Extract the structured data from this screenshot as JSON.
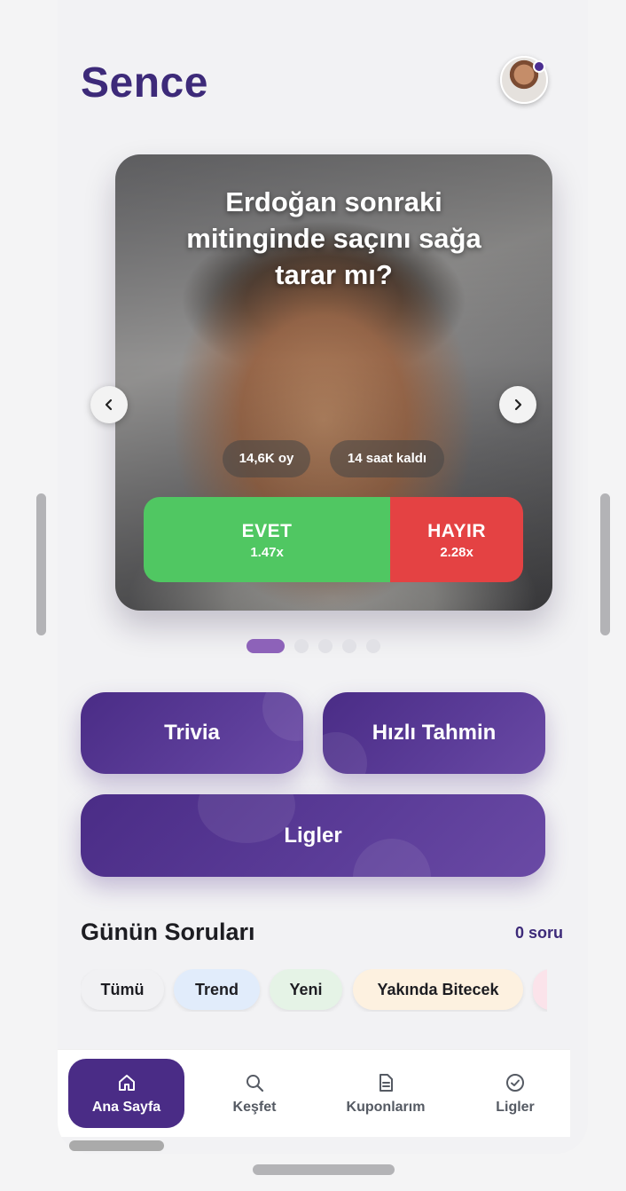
{
  "app": {
    "title": "Sence"
  },
  "hero_card": {
    "question": "Erdoğan sonraki mitinginde saçını sağa tarar mı?",
    "votes": "14,6K oy",
    "time_left": "14 saat kaldı",
    "yes": {
      "label": "EVET",
      "odds": "1.47x"
    },
    "no": {
      "label": "HAYIR",
      "odds": "2.28x"
    },
    "yes_share": 0.65
  },
  "carousel": {
    "total": 5,
    "active_index": 0
  },
  "games": {
    "trivia": "Trivia",
    "quick_guess": "Hızlı Tahmin",
    "leagues": "Ligler"
  },
  "section": {
    "title": "Günün Soruları",
    "count": "0 soru"
  },
  "filters": [
    {
      "label": "Tümü",
      "color": "#f1f1f3"
    },
    {
      "label": "Trend",
      "color": "#e1ecfb"
    },
    {
      "label": "Yeni",
      "color": "#e5f3e6"
    },
    {
      "label": "Yakında Bitecek",
      "color": "#fdf1e0"
    },
    {
      "label": "",
      "color": "#fbe3ea"
    }
  ],
  "bottom_nav": [
    {
      "label": "Ana Sayfa",
      "icon": "home-icon",
      "active": true
    },
    {
      "label": "Keşfet",
      "icon": "search-icon",
      "active": false
    },
    {
      "label": "Kuponlarım",
      "icon": "document-icon",
      "active": false
    },
    {
      "label": "Ligler",
      "icon": "check-badge-icon",
      "active": false
    }
  ],
  "colors": {
    "brand": "#3d2a79",
    "yes": "#50c762",
    "no": "#e44243",
    "nav_active": "#4a2c86"
  }
}
